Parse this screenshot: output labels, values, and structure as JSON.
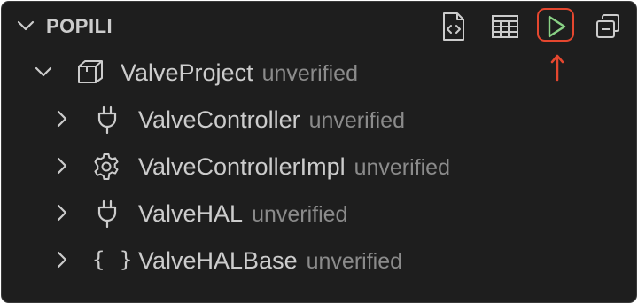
{
  "section": {
    "title": "POPILI"
  },
  "toolbar": {
    "open_file_icon": "file-code-icon",
    "table_icon": "table-icon",
    "run_icon": "play-icon",
    "collapse_icon": "collapse-all-icon",
    "highlight_color": "#e5472f",
    "run_color": "#89d185"
  },
  "tree": {
    "root": {
      "name": "ValveProject",
      "status": "unverified",
      "icon": "package-icon",
      "expanded": true
    },
    "children": [
      {
        "name": "ValveController",
        "status": "unverified",
        "icon": "plug-icon",
        "expanded": false
      },
      {
        "name": "ValveControllerImpl",
        "status": "unverified",
        "icon": "gear-icon",
        "expanded": false
      },
      {
        "name": "ValveHAL",
        "status": "unverified",
        "icon": "plug-icon",
        "expanded": false
      },
      {
        "name": "ValveHALBase",
        "status": "unverified",
        "icon": "braces-icon",
        "expanded": false
      }
    ]
  },
  "colors": {
    "background": "#1e1e1e",
    "text": "#cccccc",
    "muted": "#8b8b8b"
  }
}
